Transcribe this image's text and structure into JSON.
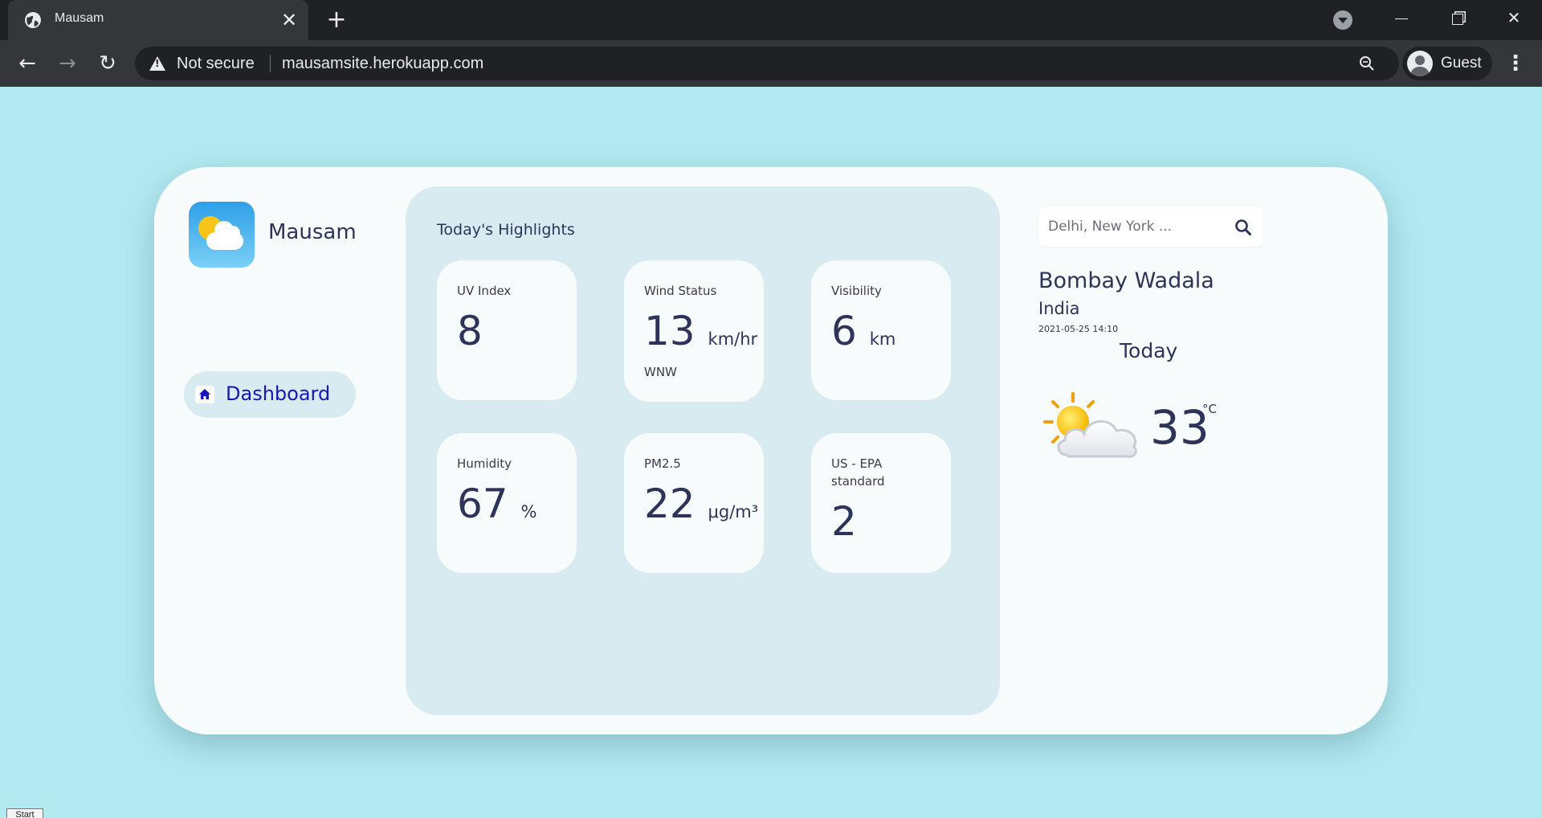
{
  "browser": {
    "tab_title": "Mausam",
    "tab_close": "✕",
    "new_tab": "+",
    "security_label": "Not secure",
    "url": "mausamsite.herokuapp.com",
    "profile_label": "Guest",
    "menu": "⋮",
    "nav_back": "←",
    "nav_forward": "→",
    "nav_reload": "↻",
    "window_close": "✕"
  },
  "app": {
    "logo_text": "Mausam",
    "nav": {
      "dashboard_label": "Dashboard"
    },
    "highlights": {
      "title": "Today's Highlights",
      "cards": [
        {
          "label": "UV Index",
          "value": "8",
          "unit": "",
          "sub": ""
        },
        {
          "label": "Wind Status",
          "value": "13",
          "unit": "km/hr",
          "sub": "WNW"
        },
        {
          "label": "Visibility",
          "value": "6",
          "unit": "km",
          "sub": ""
        },
        {
          "label": "Humidity",
          "value": "67",
          "unit": "%",
          "sub": ""
        },
        {
          "label": "PM2.5",
          "value": "22",
          "unit": "μg/m³",
          "sub": ""
        },
        {
          "label": "US - EPA standard",
          "value": "2",
          "unit": "",
          "sub": ""
        }
      ]
    },
    "search": {
      "placeholder": "Delhi, New York ...",
      "value": ""
    },
    "location": {
      "city": "Bombay Wadala",
      "country": "India",
      "datetime": "2021-05-25 14:10"
    },
    "today_label": "Today",
    "temperature": {
      "value": "33",
      "unit": "°C"
    },
    "weather_icon": "partly-cloudy-icon"
  },
  "taskbar": {
    "start_label": "Start"
  },
  "colors": {
    "page_bg": "#b3e9f1",
    "card_bg": "#f8fbfb",
    "highlights_bg": "#d8ebf0",
    "text_primary": "#2e3459",
    "nav_active_text": "#1816b8"
  }
}
